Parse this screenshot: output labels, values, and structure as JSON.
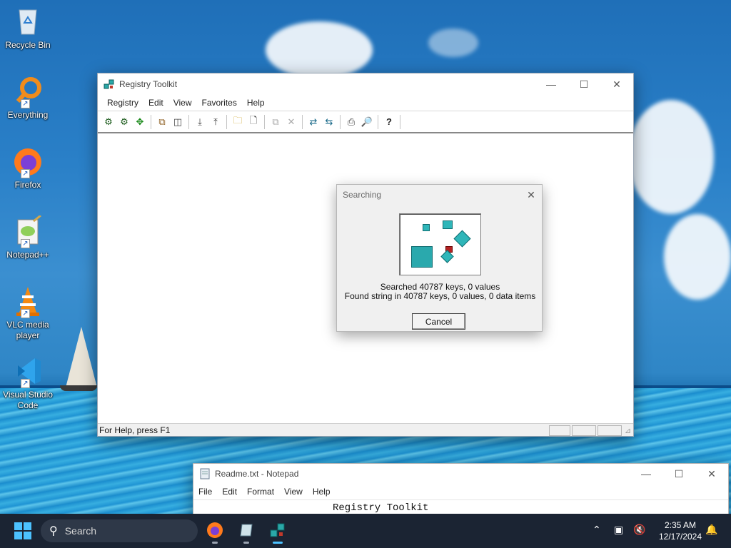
{
  "desktop": {
    "icons": [
      {
        "label": "Recycle Bin"
      },
      {
        "label": "Everything"
      },
      {
        "label": "Firefox"
      },
      {
        "label": "Notepad++"
      },
      {
        "label": "VLC media player"
      },
      {
        "label": "Visual Studio Code"
      }
    ]
  },
  "registry_window": {
    "title": "Registry Toolkit",
    "menu": [
      "Registry",
      "Edit",
      "View",
      "Favorites",
      "Help"
    ],
    "status_text": "For Help, press F1",
    "toolbar_icons": [
      "find-icon",
      "find-next-icon",
      "goto-icon",
      "copy-key-icon",
      "compare-icon",
      "export-icon",
      "import-icon",
      "open-folder-icon",
      "new-file-icon",
      "properties-icon",
      "delete-icon",
      "connect-icon",
      "disconnect-icon",
      "print-icon",
      "print-preview-icon",
      "help-icon"
    ]
  },
  "search_dialog": {
    "title": "Searching",
    "line1": "Searched 40787 keys, 0 values",
    "line2": "Found string in 40787 keys, 0 values, 0 data items",
    "cancel_label": "Cancel"
  },
  "notepad_window": {
    "title": "Readme.txt - Notepad",
    "menu": [
      "File",
      "Edit",
      "Format",
      "View",
      "Help"
    ],
    "content": "Registry Toolkit"
  },
  "taskbar": {
    "search_placeholder": "Search",
    "time": "2:35 AM",
    "date": "12/17/2024"
  }
}
